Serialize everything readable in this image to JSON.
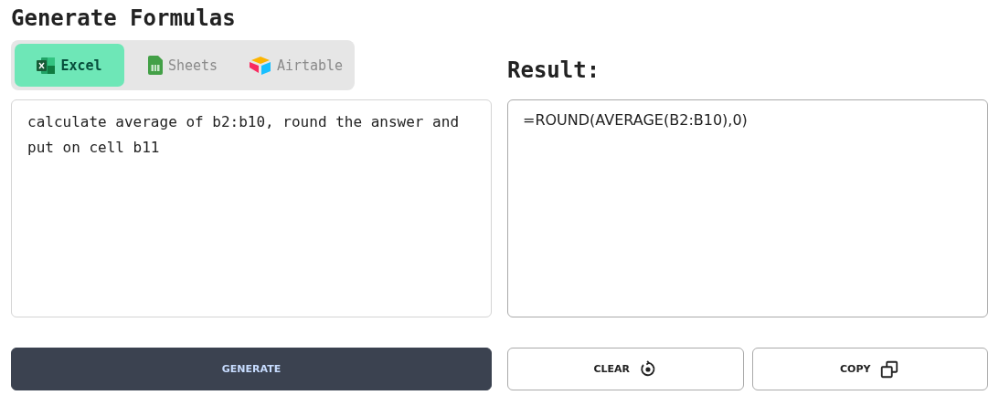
{
  "title": "Generate Formulas",
  "tabs": [
    {
      "label": "Excel",
      "kind": "excel",
      "selected": true
    },
    {
      "label": "Sheets",
      "kind": "sheets",
      "selected": false
    },
    {
      "label": "Airtable",
      "kind": "airtable",
      "selected": false
    }
  ],
  "prompt": {
    "value": "calculate average of b2:b10, round the answer and put on cell b11"
  },
  "result": {
    "label": "Result:",
    "value": "=ROUND(AVERAGE(B2:B10),0)"
  },
  "buttons": [
    {
      "label": "GENERATE",
      "kind": "primary"
    },
    {
      "label": "CLEAR",
      "kind": "clear"
    },
    {
      "label": "COPY",
      "kind": "copy"
    }
  ]
}
